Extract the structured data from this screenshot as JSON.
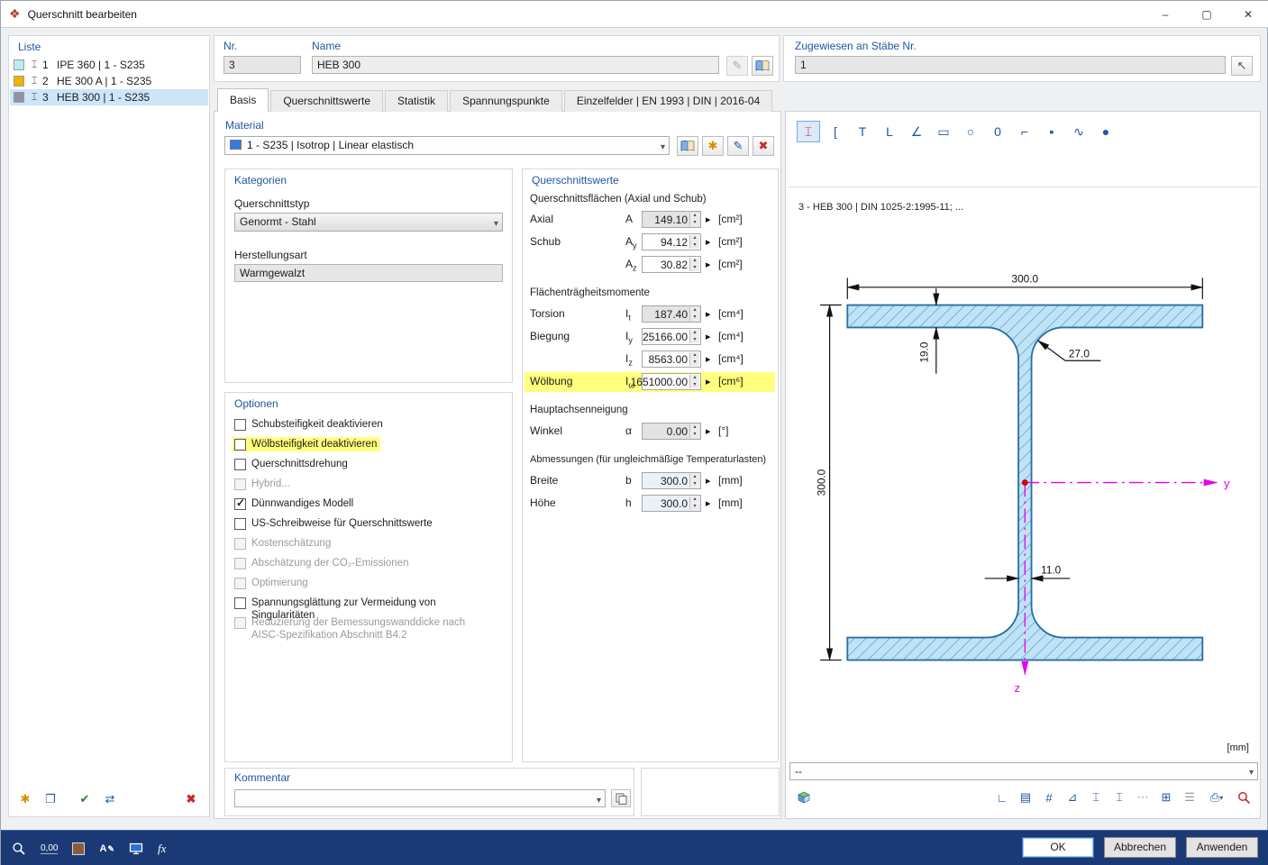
{
  "window": {
    "title": "Querschnitt bearbeiten",
    "minimize": "–",
    "maximize": "▢",
    "close": "✕"
  },
  "liste": {
    "title": "Liste",
    "items": [
      {
        "nr": "1",
        "name": "IPE 360 | 1 - S235",
        "color": "#b9eef0",
        "selected": false
      },
      {
        "nr": "2",
        "name": "HE 300 A | 1 - S235",
        "color": "#f0b400",
        "selected": false
      },
      {
        "nr": "3",
        "name": "HEB 300 | 1 - S235",
        "color": "#8f93a6",
        "selected": true
      }
    ]
  },
  "header": {
    "nr_label": "Nr.",
    "nr_value": "3",
    "name_label": "Name",
    "name_value": "HEB 300",
    "assigned_label": "Zugewiesen an Stäbe Nr.",
    "assigned_value": "1"
  },
  "tabs": {
    "basis": "Basis",
    "werte": "Querschnittswerte",
    "statistik": "Statistik",
    "spannungspunkte": "Spannungspunkte",
    "einzelfelder": "Einzelfelder | EN 1993 | DIN | 2016-04"
  },
  "material": {
    "title": "Material",
    "value": "1 - S235 | Isotrop | Linear elastisch",
    "swatch_color": "#2f7de1"
  },
  "kategorien": {
    "title": "Kategorien",
    "typ_label": "Querschnittstyp",
    "typ_value": "Genormt - Stahl",
    "herstellung_label": "Herstellungsart",
    "herstellung_value": "Warmgewalzt"
  },
  "optionen": {
    "title": "Optionen",
    "items": [
      {
        "label": "Schubsteifigkeit deaktivieren",
        "checked": false,
        "disabled": false,
        "highlight": false
      },
      {
        "label": "Wölbsteifigkeit deaktivieren",
        "checked": false,
        "disabled": false,
        "highlight": true
      },
      {
        "label": "Querschnittsdrehung",
        "checked": false,
        "disabled": false,
        "highlight": false
      },
      {
        "label": "Hybrid...",
        "checked": false,
        "disabled": true,
        "highlight": false
      },
      {
        "label": "Dünnwandiges Modell",
        "checked": true,
        "disabled": false,
        "highlight": false
      },
      {
        "label": "US-Schreibweise für Querschnittswerte",
        "checked": false,
        "disabled": false,
        "highlight": false
      },
      {
        "label": "Kostenschätzung",
        "checked": false,
        "disabled": true,
        "highlight": false
      },
      {
        "label": "Abschätzung der CO₂-Emissionen",
        "checked": false,
        "disabled": true,
        "highlight": false
      },
      {
        "label": "Optimierung",
        "checked": false,
        "disabled": true,
        "highlight": false
      },
      {
        "label": "Spannungsglättung zur Vermeidung von Singularitäten",
        "checked": false,
        "disabled": false,
        "highlight": false
      },
      {
        "label": "Reduzierung der Bemessungswanddicke nach AISC-Spezifikation Abschnitt B4.2",
        "checked": false,
        "disabled": true,
        "highlight": false
      }
    ]
  },
  "werte": {
    "title": "Querschnittswerte",
    "groups": [
      {
        "title": "Querschnittsflächen (Axial und Schub)",
        "rows": [
          {
            "label": "Axial",
            "sym": "A",
            "sub": "",
            "value": "149.10",
            "unit": "[cm²]",
            "readonly": true
          },
          {
            "label": "Schub",
            "sym": "A",
            "sub": "y",
            "value": "94.12",
            "unit": "[cm²]",
            "readonly": false
          },
          {
            "label": "",
            "sym": "A",
            "sub": "z",
            "value": "30.82",
            "unit": "[cm²]",
            "readonly": false
          }
        ]
      },
      {
        "title": "Flächenträgheitsmomente",
        "rows": [
          {
            "label": "Torsion",
            "sym": "I",
            "sub": "t",
            "value": "187.40",
            "unit": "[cm⁴]",
            "readonly": true
          },
          {
            "label": "Biegung",
            "sym": "I",
            "sub": "y",
            "value": "25166.00",
            "unit": "[cm⁴]",
            "readonly": false
          },
          {
            "label": "",
            "sym": "I",
            "sub": "z",
            "value": "8563.00",
            "unit": "[cm⁴]",
            "readonly": false
          },
          {
            "label": "Wölbung",
            "sym": "I",
            "sub": "ω",
            "value": "1651000.00",
            "unit": "[cm⁶]",
            "readonly": false,
            "highlight": true
          }
        ]
      },
      {
        "title": "Hauptachsenneigung",
        "rows": [
          {
            "label": "Winkel",
            "sym": "α",
            "sub": "",
            "value": "0.00",
            "unit": "[°]",
            "readonly": true
          }
        ]
      },
      {
        "title": "Abmessungen (für ungleichmäßige Temperaturlasten)",
        "rows": [
          {
            "label": "Breite",
            "sym": "b",
            "sub": "",
            "value": "300.0",
            "unit": "[mm]",
            "readonly": false
          },
          {
            "label": "Höhe",
            "sym": "h",
            "sub": "",
            "value": "300.0",
            "unit": "[mm]",
            "readonly": false
          }
        ]
      }
    ]
  },
  "kommentar": {
    "title": "Kommentar",
    "value": ""
  },
  "shapes": {
    "glyphs": [
      "⌶",
      "[",
      "T",
      "L",
      "∠",
      "▭",
      "○",
      "0",
      "⌐",
      "▪",
      "∿",
      "●"
    ]
  },
  "preview": {
    "caption": "3 - HEB 300 | DIN 1025-2:1995-11; ...",
    "unit": "[mm]",
    "combo": "--",
    "dims": {
      "b": "300.0",
      "h": "300.0",
      "tf": "19.0",
      "r": "27.0",
      "tw": "11.0",
      "y": "y",
      "z": "z"
    },
    "tools": [
      "∟",
      "▤",
      "#",
      "⊿",
      "⌶",
      "⌶",
      "⋯",
      "⊞",
      "☰",
      "⎙"
    ]
  },
  "footer": {
    "ok": "OK",
    "cancel": "Abbrechen",
    "apply": "Anwenden",
    "decimals": "0,00",
    "fx": "fx"
  },
  "colors": {
    "highlight": "#ffff7d",
    "selection": "#cde5f9",
    "footer": "#1b3a75",
    "hatch_fill": "#bfe3f5",
    "axis": "#e800e8"
  }
}
